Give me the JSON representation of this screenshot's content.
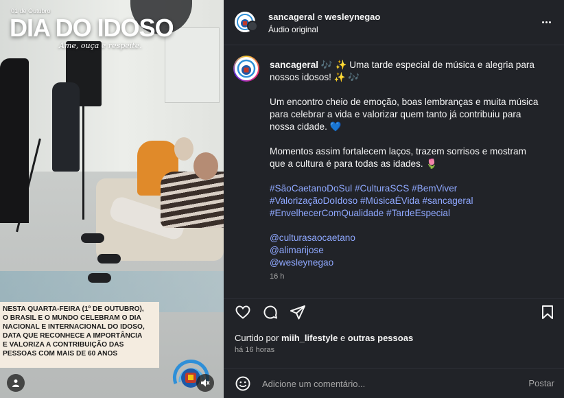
{
  "media": {
    "overlay_date": "01 de Outubro",
    "overlay_title": "DIA DO IDOSO",
    "overlay_tagline": "Ame, ouça e respeite.",
    "caption_lines": [
      "NESTA QUARTA-FEIRA (1º DE OUTUBRO),",
      "O BRASIL E O MUNDO CELEBRAM O DIA",
      "NACIONAL E INTERNACIONAL DO IDOSO,",
      "DATA QUE RECONHECE A IMPORTÂNCIA",
      "E VALORIZA A CONTRIBUIÇÃO DAS",
      "PESSOAS COM MAIS DE 60 ANOS"
    ],
    "logo_text": "SANCA",
    "user_icon": "user-icon",
    "mute_icon": "speaker-muted-icon"
  },
  "header": {
    "author1": "sancageral",
    "connector": "e",
    "author2": "wesleynegao",
    "subtitle": "Áudio original"
  },
  "caption": {
    "author": "sancageral",
    "intro": "🎶 ✨ Uma tarde especial de música e alegria para nossos idosos! ✨ 🎶",
    "para2": "Um encontro cheio de emoção, boas lembranças e muita música para celebrar a vida e valorizar quem tanto já contribuiu para nossa cidade. 💙",
    "para3": "Momentos assim fortalecem laços, trazem sorrisos e mostram que a cultura é para todas as idades. 🌷",
    "hashtags": [
      "#SãoCaetanoDoSul",
      "#CulturaSCS",
      "#BemViver",
      "#ValorizaçãoDoIdoso",
      "#MúsicaÉVida",
      "#sancageral",
      "#EnvelhecerComQualidade",
      "#TardeEspecial"
    ],
    "mentions": [
      "@culturasaocaetano",
      "@alimarijose",
      "@wesleynegao"
    ],
    "time": "16 h"
  },
  "actions": {
    "liked_by_prefix": "Curtido por",
    "liked_by_user": "miih_lifestyle",
    "liked_by_connector": "e",
    "liked_by_others": "outras pessoas",
    "time_ago": "há 16 horas"
  },
  "comment": {
    "placeholder": "Adicione um comentário...",
    "post_label": "Postar"
  },
  "colors": {
    "panel_bg": "#212328",
    "link": "#8fa8ff",
    "muted": "#a8a8a8"
  }
}
